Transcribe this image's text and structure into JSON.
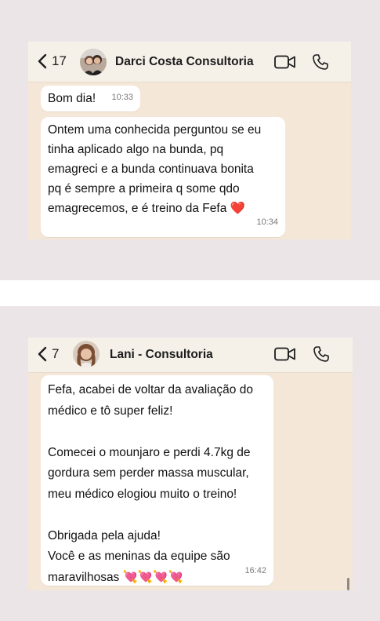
{
  "chat1": {
    "back_count": "17",
    "contact_name": "Darci Costa Consultoria",
    "messages": [
      {
        "text": "Bom dia!",
        "time": "10:33"
      },
      {
        "text": "Ontem uma conhecida perguntou se eu\ntinha aplicado algo na bunda, pq\nemagreci e a bunda continuava bonita\npq é sempre a primeira q some qdo\nemagrecemos, e é treino da Fefa ❤️",
        "time": "10:34"
      }
    ]
  },
  "chat2": {
    "back_count": "7",
    "contact_name": "Lani - Consultoria",
    "messages": [
      {
        "text": "Fefa, acabei de voltar da avaliação do\nmédico e tô super feliz!\n\nComecei o mounjaro e perdi 4.7kg de\ngordura sem perder massa muscular,\nmeu médico elogiou muito o treino!\n\nObrigada pela ajuda!\nVocê e as meninas da equipe são\nmaravilhosas 💘💘💘💘",
        "time": "16:42"
      }
    ]
  },
  "icons": {
    "back": "chevron-left-icon",
    "video": "video-call-icon",
    "phone": "phone-call-icon"
  },
  "colors": {
    "chat_background": "#f5e7d7",
    "page_background": "#ebe5e7",
    "bubble": "#ffffff"
  }
}
